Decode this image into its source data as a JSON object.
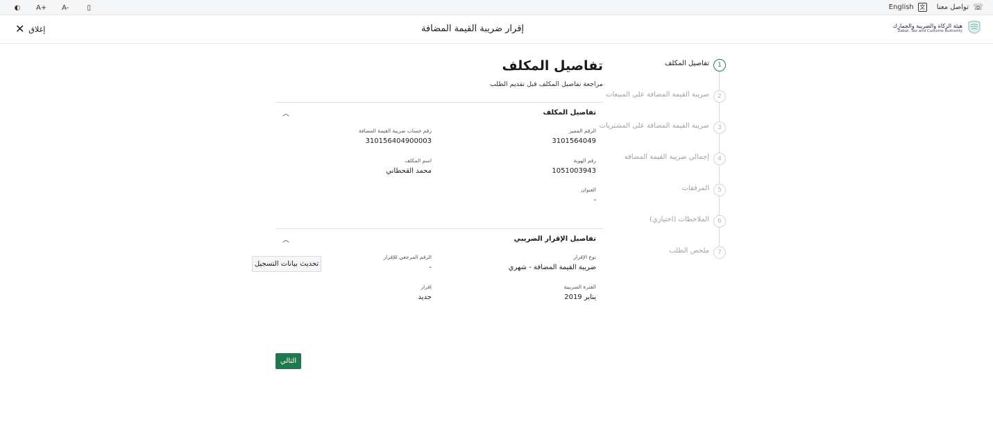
{
  "utility_bar": {
    "contact_label": "تواصل معنا",
    "language_label": "English",
    "font_increase": "A+",
    "font_decrease": "A-"
  },
  "header": {
    "title": "إقرار ضريبة القيمة المضافة",
    "close_label": "إغلاق",
    "logo_ar": "هيئة الزكاة والضريبة والجمارك",
    "logo_en": "Zakat, Tax and Customs Authority"
  },
  "stepper": {
    "steps": [
      {
        "number": "1",
        "label": "تفاصيل المكلف"
      },
      {
        "number": "2",
        "label": "ضريبة القيمة المضافة على المبيعات"
      },
      {
        "number": "3",
        "label": "ضريبة القيمة المضافة على المشتريات"
      },
      {
        "number": "4",
        "label": "إجمالي ضريبة القيمة المضافة"
      },
      {
        "number": "5",
        "label": "المرفقات"
      },
      {
        "number": "6",
        "label": "الملاحظات (اختياري)"
      },
      {
        "number": "7",
        "label": "ملخص الطلب"
      }
    ]
  },
  "main": {
    "title": "تفاصيل المكلف",
    "subtitle": "مراجعة تفاصيل المكلف قبل تقديم الطلب",
    "taxpayer_section": {
      "heading": "تفاصيل المكلف",
      "fields": {
        "tin_label": "الرقم المميز",
        "tin_value": "3101564049",
        "vat_account_label": "رقم حساب ضريبة القيمة المضافة",
        "vat_account_value": "310156404900003",
        "id_label": "رقم الهوية",
        "id_value": "1051003943",
        "name_label": "اسم المكلف",
        "name_value": "محمد القحطاني",
        "address_label": "العنوان",
        "address_value": "-"
      }
    },
    "return_section": {
      "heading": "تفاصيل الإقرار الضريبي",
      "fields": {
        "return_type_label": "نوع الإقرار",
        "return_type_value": "ضريبة القيمة المضافة - شهري",
        "reference_label": "الرقم المرجعي للإقرار",
        "reference_value": "-",
        "period_label": "الفترة الضريبية",
        "period_value": "يناير 2019",
        "return_label": "إقرار",
        "return_value": "جديد"
      },
      "update_button": "تحديث بيانات التسجيل"
    },
    "next_button": "التالي"
  },
  "colors": {
    "accent": "#1d7a4c",
    "inactive_step": "#b1b5ba"
  }
}
